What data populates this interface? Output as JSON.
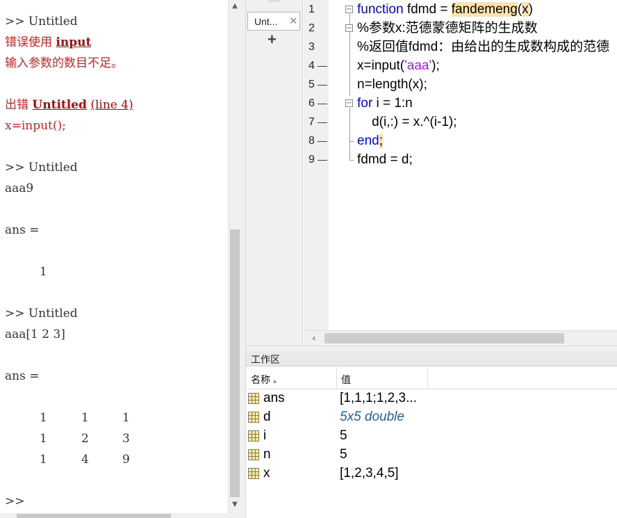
{
  "command_window": {
    "lines": [
      {
        "text": ">> Untitled"
      },
      {
        "text": "错误使用 ",
        "bold_link": "input"
      },
      {
        "text": "输入参数的数目不足。"
      },
      {
        "text": "出错 ",
        "bold_link": "Untitled",
        "suffix": "(line 4)"
      },
      {
        "text": "x=input();"
      },
      {
        "text": ">> Untitled"
      },
      {
        "text": "aaa9"
      },
      {
        "text": "ans ="
      },
      {
        "text": "1"
      },
      {
        "text": ">> Untitled"
      },
      {
        "text": "aaa[1 2 3]"
      },
      {
        "text": "ans ="
      },
      {
        "text": ">>"
      }
    ],
    "matrix": [
      [
        "1",
        "1",
        "1"
      ],
      [
        "1",
        "2",
        "3"
      ],
      [
        "1",
        "4",
        "9"
      ]
    ]
  },
  "editor": {
    "tab_label": "Unt...",
    "tab_close": "✕",
    "add_tab": "+",
    "line_numbers": [
      "1",
      "2",
      "3",
      "4",
      "5",
      "6",
      "7",
      "8",
      "9"
    ],
    "code": {
      "l1_kw": "function",
      "l1_mid": " fdmd = ",
      "l1_fn": "fandemeng",
      "l1_p1": "(",
      "l1_arg": "x",
      "l1_p2": ")",
      "l2": "%参数x:范德蒙德矩阵的生成数",
      "l3": "%返回值fdmd：由给出的生成数构成的范德",
      "l4_a": "x=input(",
      "l4_str": "'aaa'",
      "l4_b": ");",
      "l5": "n=length(x);",
      "l6_kw": "for",
      "l6_rest": " i = 1:n",
      "l7": "    d(i,:) = x.^(i-1);",
      "l8_kw": "end",
      "l8_semi": ";",
      "l9": "fdmd = d;"
    }
  },
  "workspace": {
    "title": "工作区",
    "col_name": "名称",
    "col_value": "值",
    "rows": [
      {
        "name": "ans",
        "value": "[1,1,1;1,2,3..."
      },
      {
        "name": "d",
        "value": "5x5 double"
      },
      {
        "name": "i",
        "value": "5"
      },
      {
        "name": "n",
        "value": "5"
      },
      {
        "name": "x",
        "value": "[1,2,3,4,5]"
      }
    ]
  },
  "colors": {
    "keyword": "#0000ff",
    "comment": "#228b22",
    "string": "#a020f0",
    "error": "#e02020"
  }
}
